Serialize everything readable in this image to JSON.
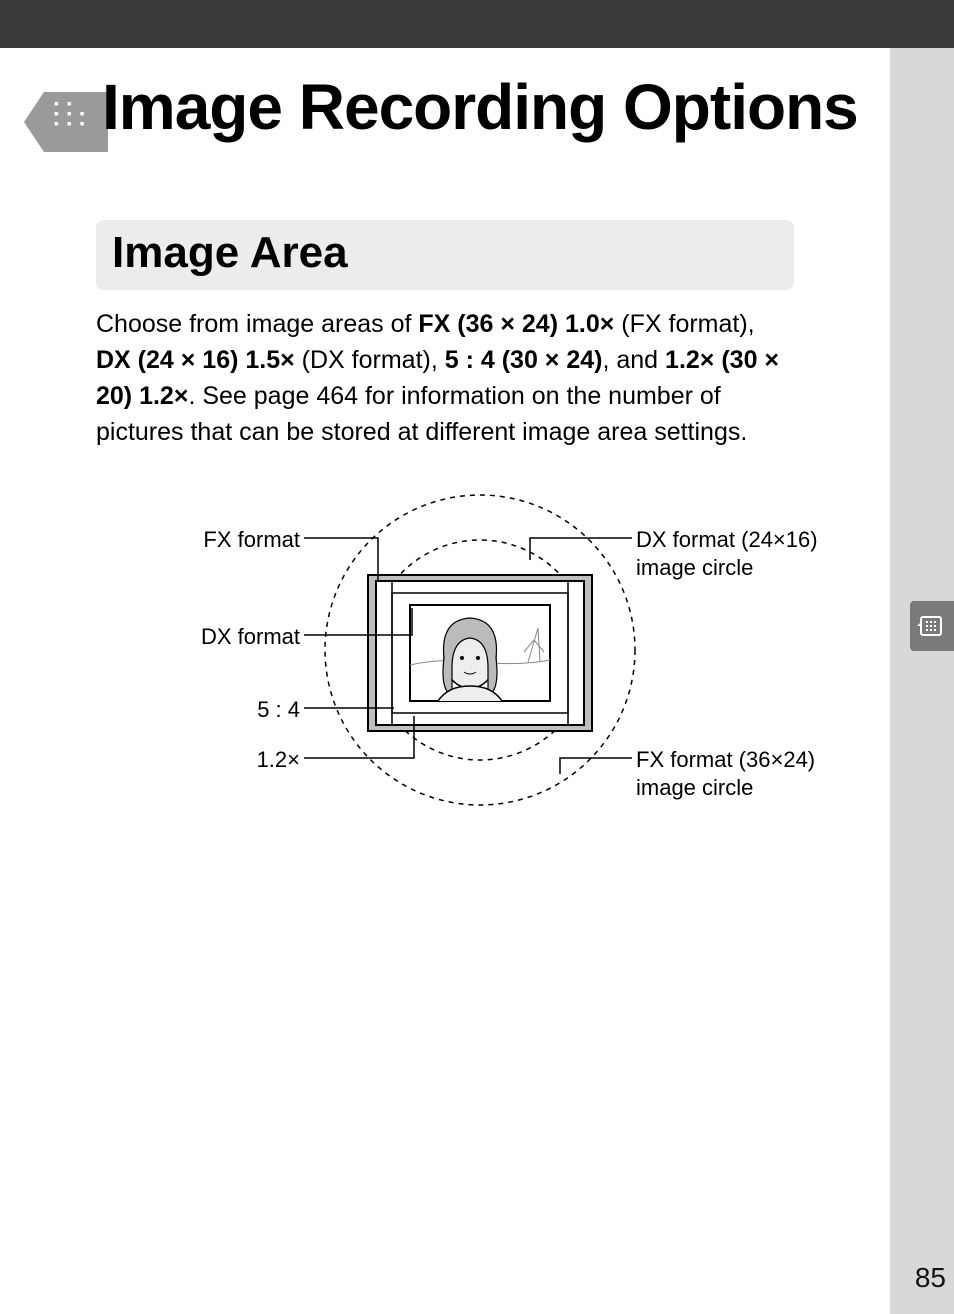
{
  "page_number": "85",
  "chapter_title": "Image Recording Options",
  "section_title": "Image Area",
  "body": {
    "t1": "Choose from image areas of ",
    "b1": "FX (36 × 24) 1.0×",
    "t2": " (FX format), ",
    "b2": "DX (24 × 16) 1.5×",
    "t3": " (DX format), ",
    "b3": "5 : 4 (30 × 24)",
    "t4": ", and ",
    "b4": "1.2× (30 × 20) 1.2×",
    "t5": ". See page 464 for information on the number of pictures that can be stored at different image area settings."
  },
  "diagram": {
    "fx_format": "FX format",
    "dx_format": "DX format",
    "five_four": "5 : 4",
    "one_two_x": "1.2×",
    "dx_circle": "DX format (24×16) image circle",
    "fx_circle": "FX format (36×24) image circle"
  }
}
